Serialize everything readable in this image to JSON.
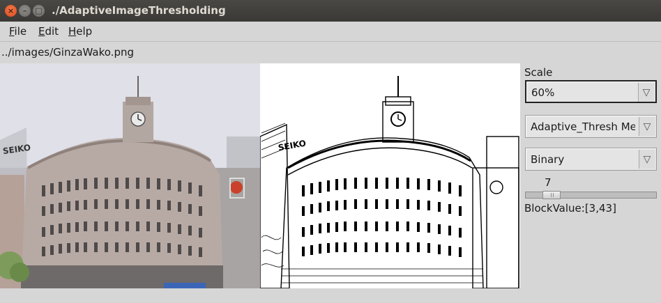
{
  "window": {
    "title": "./AdaptiveImageThresholding",
    "close_glyph": "×",
    "minimize_glyph": "–",
    "maximize_glyph": "□"
  },
  "menu": [
    "File",
    "Edit",
    "Help"
  ],
  "image_path": "../images/GinzaWako.png",
  "panels": {
    "original": "photo-of-ginza-wako-building",
    "thresholded": "thresholded-ginza-wako-building"
  },
  "controls": {
    "scale_label": "Scale",
    "scale_value": "60%",
    "method_value": "Adaptive_Thresh Me",
    "threshold_type_value": "Binary",
    "combo_arrow": "▽",
    "slider_value": "7",
    "slider_fraction": 0.15,
    "block_value_label": "BlockValue:[3,43]"
  },
  "colors": {
    "titlebar": "#3c3b37",
    "window_bg": "#d6d6d6",
    "close_button": "#e8572b"
  }
}
